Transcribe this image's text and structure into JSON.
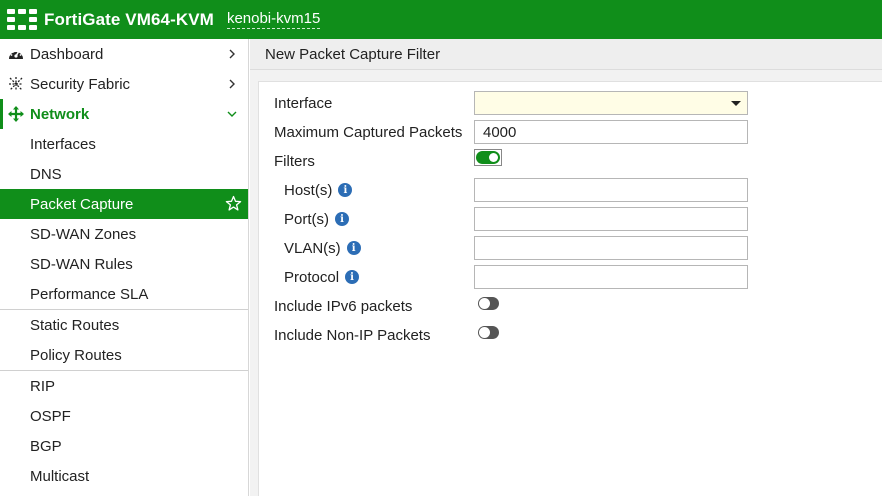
{
  "header": {
    "app_title": "FortiGate VM64-KVM",
    "host_name": "kenobi-kvm15",
    "accent_color": "#108e1a"
  },
  "sidebar": {
    "items": [
      {
        "label": "Dashboard",
        "icon": "dashboard-icon"
      },
      {
        "label": "Security Fabric",
        "icon": "security-fabric-icon"
      },
      {
        "label": "Network",
        "icon": "network-icon"
      },
      {
        "label": "Interfaces"
      },
      {
        "label": "DNS"
      },
      {
        "label": "Packet Capture"
      },
      {
        "label": "SD-WAN Zones"
      },
      {
        "label": "SD-WAN Rules"
      },
      {
        "label": "Performance SLA"
      },
      {
        "label": "Static Routes"
      },
      {
        "label": "Policy Routes"
      },
      {
        "label": "RIP"
      },
      {
        "label": "OSPF"
      },
      {
        "label": "BGP"
      },
      {
        "label": "Multicast"
      }
    ]
  },
  "main": {
    "title": "New Packet Capture Filter",
    "form": {
      "interface_label": "Interface",
      "interface_value": "",
      "max_packets_label": "Maximum Captured Packets",
      "max_packets_value": "4000",
      "filters_label": "Filters",
      "filters_enabled": true,
      "hosts_label": "Host(s)",
      "hosts_value": "",
      "ports_label": "Port(s)",
      "ports_value": "",
      "vlans_label": "VLAN(s)",
      "vlans_value": "",
      "protocol_label": "Protocol",
      "protocol_value": "",
      "ipv6_label": "Include IPv6 packets",
      "ipv6_enabled": false,
      "nonip_label": "Include Non-IP Packets",
      "nonip_enabled": false
    }
  }
}
